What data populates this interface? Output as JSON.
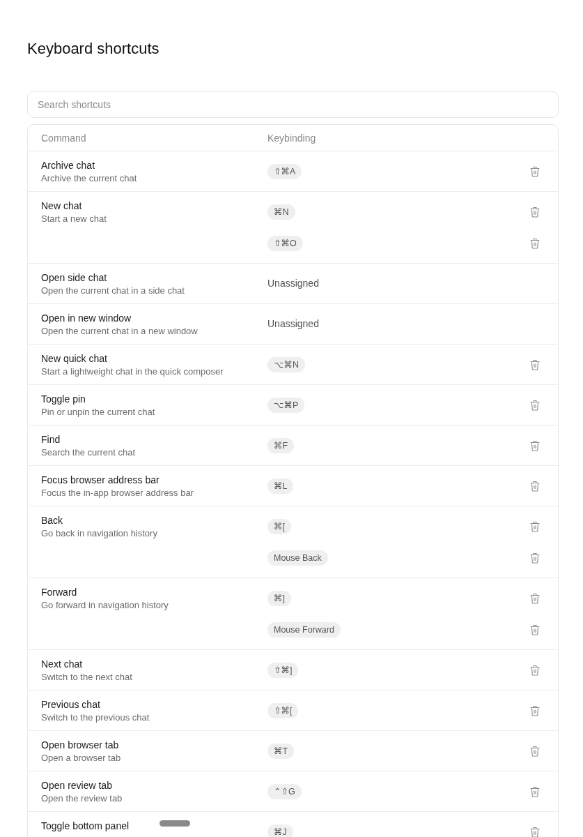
{
  "title": "Keyboard shortcuts",
  "search": {
    "placeholder": "Search shortcuts"
  },
  "table": {
    "columns": [
      "Command",
      "Keybinding"
    ],
    "rows": [
      {
        "command": "Archive chat",
        "description": "Archive the current chat",
        "keybindings": [
          "⇧⌘A"
        ]
      },
      {
        "command": "New chat",
        "description": "Start a new chat",
        "keybindings": [
          "⌘N",
          "⇧⌘O"
        ]
      },
      {
        "command": "Open side chat",
        "description": "Open the current chat in a side chat",
        "binding_text": "Unassigned"
      },
      {
        "command": "Open in new window",
        "description": "Open the current chat in a new window",
        "binding_text": "Unassigned"
      },
      {
        "command": "New quick chat",
        "description": "Start a lightweight chat in the quick composer",
        "keybindings": [
          "⌥⌘N"
        ]
      },
      {
        "command": "Toggle pin",
        "description": "Pin or unpin the current chat",
        "keybindings": [
          "⌥⌘P"
        ]
      },
      {
        "command": "Find",
        "description": "Search the current chat",
        "keybindings": [
          "⌘F"
        ]
      },
      {
        "command": "Focus browser address bar",
        "description": "Focus the in-app browser address bar",
        "keybindings": [
          "⌘L"
        ]
      },
      {
        "command": "Back",
        "description": "Go back in navigation history",
        "keybindings": [
          "⌘[",
          "Mouse Back"
        ]
      },
      {
        "command": "Forward",
        "description": "Go forward in navigation history",
        "keybindings": [
          "⌘]",
          "Mouse Forward"
        ]
      },
      {
        "command": "Next chat",
        "description": "Switch to the next chat",
        "keybindings": [
          "⇧⌘]"
        ]
      },
      {
        "command": "Previous chat",
        "description": "Switch to the previous chat",
        "keybindings": [
          "⇧⌘["
        ]
      },
      {
        "command": "Open browser tab",
        "description": "Open a browser tab",
        "keybindings": [
          "⌘T"
        ]
      },
      {
        "command": "Open review tab",
        "description": "Open the review tab",
        "keybindings": [
          "⌃⇧G"
        ]
      },
      {
        "command": "Toggle bottom panel",
        "keybindings": [
          "⌘J"
        ]
      }
    ]
  }
}
